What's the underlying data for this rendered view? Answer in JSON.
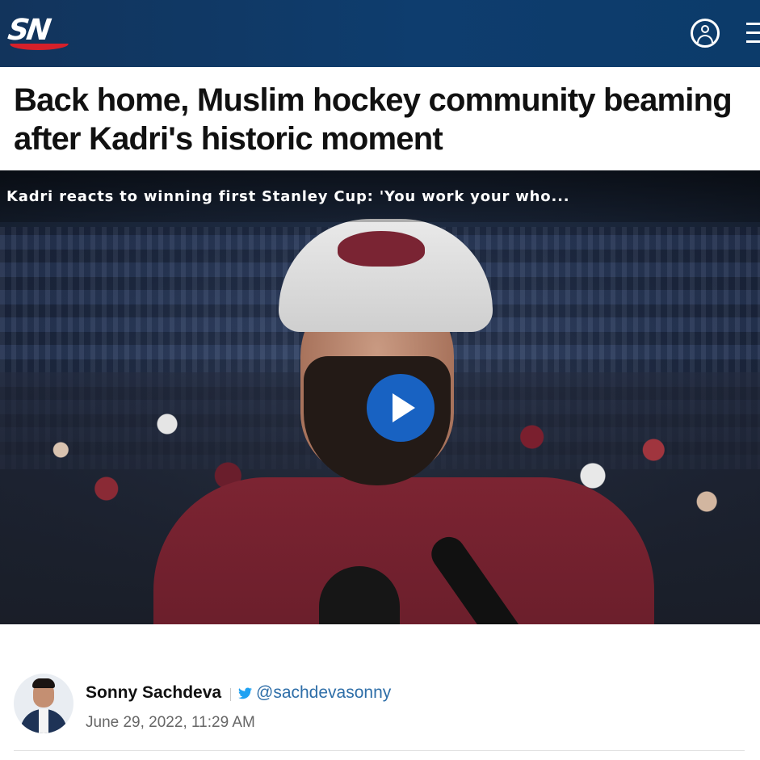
{
  "header": {
    "logo_text": "SN",
    "account_icon": "user-circle-icon",
    "menu_icon": "hamburger-menu-icon"
  },
  "article": {
    "headline": "Back home, Muslim hockey community beaming after Kadri's historic moment"
  },
  "video": {
    "title": "Kadri reacts to winning first Stanley Cup: 'You work your who...",
    "play_icon": "play-icon"
  },
  "byline": {
    "author": "Sonny Sachdeva",
    "twitter_handle": "@sachdevasonny",
    "date": "June 29, 2022, 11:29 AM",
    "twitter_icon": "twitter-bird-icon"
  },
  "colors": {
    "header_bg": "#0e3d6e",
    "play_button": "#1862c2",
    "link": "#2e6ea8",
    "logo_accent": "#d6202a"
  }
}
